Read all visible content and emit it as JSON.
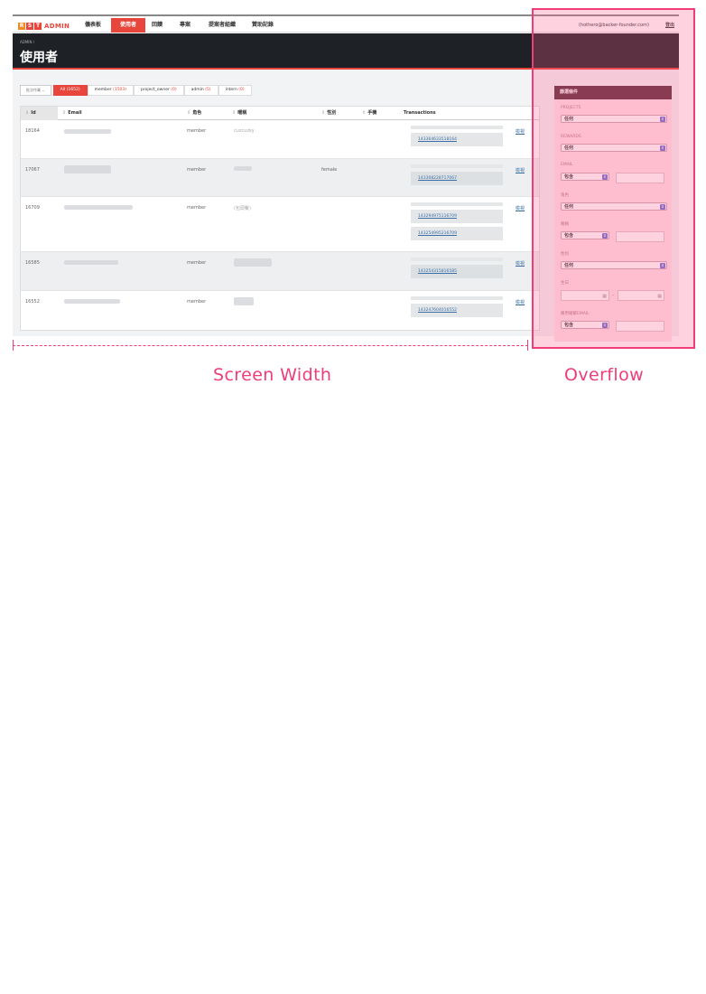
{
  "logo": {
    "letters": [
      "R",
      "S",
      "T"
    ],
    "word": "ADMIN"
  },
  "nav": {
    "items": [
      {
        "label": "儀表板",
        "active": false
      },
      {
        "label": "使用者",
        "active": true
      },
      {
        "label": "回饋",
        "active": false
      },
      {
        "label": "專案",
        "active": false
      },
      {
        "label": "提案者組織",
        "active": false
      },
      {
        "label": "贊助記錄",
        "active": false
      }
    ],
    "user_email": "(hothero@backer-founder.com)",
    "logout": "登出"
  },
  "header": {
    "breadcrumb": "ADMIN /",
    "title": "使用者"
  },
  "filters": {
    "bulk_label": "批次作業 ⌄",
    "tabs": [
      {
        "label": "All",
        "count": "(1652)",
        "active": true
      },
      {
        "label": "member",
        "count": "(1503)",
        "active": false
      },
      {
        "label": "project_owner",
        "count": "(0)",
        "active": false
      },
      {
        "label": "admin",
        "count": "(5)",
        "active": false
      },
      {
        "label": "intern",
        "count": "(0)",
        "active": false
      }
    ]
  },
  "table": {
    "columns": [
      "Id",
      "Email",
      "角色",
      "暱稱",
      "性別",
      "手機",
      "Transactions",
      ""
    ],
    "rows": [
      {
        "id": "18164",
        "role": "member",
        "nickname": "cuzcuzky",
        "gender": "",
        "transactions": [
          "143364633518164"
        ],
        "action": "檢視"
      },
      {
        "id": "17067",
        "role": "member",
        "nickname": "",
        "gender": "female",
        "transactions": [
          "143308228717067"
        ],
        "action": "檢視"
      },
      {
        "id": "16709",
        "role": "member",
        "nickname": "(包頭鬢)",
        "gender": "",
        "transactions": [
          "143294975116709",
          "143254995216709"
        ],
        "action": "檢視"
      },
      {
        "id": "16585",
        "role": "member",
        "nickname": "",
        "gender": "",
        "transactions": [
          "143254315816585"
        ],
        "action": "檢視"
      },
      {
        "id": "16552",
        "role": "member",
        "nickname": "",
        "gender": "",
        "transactions": [
          "143247604016552"
        ],
        "action": "檢視"
      }
    ]
  },
  "panel": {
    "title": "篩選條件",
    "projects_label": "PROJECTS",
    "projects_value": "任何",
    "rewards_label": "REWARDS",
    "rewards_value": "任何",
    "email_label": "EMAIL",
    "email_op": "包含",
    "role_label": "角色",
    "role_value": "任何",
    "nickname_label": "暱稱",
    "nickname_op": "包含",
    "gender_label": "性別",
    "gender_value": "任何",
    "birthday_label": "生日",
    "date_separator": "-",
    "backup_email_label": "備用聯繫EMAIL",
    "backup_email_op": "包含"
  },
  "captions": {
    "screen_width": "Screen Width",
    "overflow": "Overflow"
  },
  "colors": {
    "accent": "#e8453c",
    "overlay": "#ee3d77",
    "header_bg": "#1e2227"
  }
}
